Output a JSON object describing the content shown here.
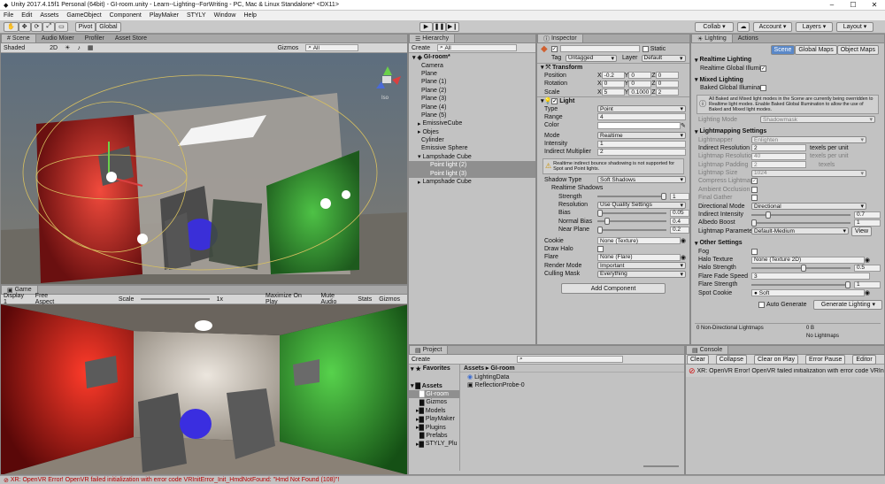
{
  "window": {
    "title": "Unity 2017.4.15f1 Personal (64bit) - GI-room.unity - Learn--Lighting--ForWriting - PC, Mac & Linux Standalone* <DX11>"
  },
  "menu": [
    "File",
    "Edit",
    "Assets",
    "GameObject",
    "Component",
    "PlayMaker",
    "STYLY",
    "Window",
    "Help"
  ],
  "toolbar": {
    "pivot": "Pivot",
    "global": "Global",
    "collab": "Collab",
    "account": "Account",
    "layers": "Layers",
    "layout": "Layout"
  },
  "scene": {
    "tabs": [
      "Scene",
      "Audio Mixer",
      "Profiler",
      "Asset Store"
    ],
    "shading": "Shaded",
    "mode2d": "2D",
    "gizmos": "Gizmos",
    "search": "All",
    "persp": "Iso"
  },
  "game": {
    "tab": "Game",
    "display": "Display 1",
    "aspect": "Free Aspect",
    "scale_label": "Scale",
    "scale_value": "1x",
    "opts": [
      "Maximize On Play",
      "Mute Audio",
      "Stats",
      "Gizmos"
    ]
  },
  "hierarchy": {
    "tab": "Hierarchy",
    "create": "Create",
    "search": "All",
    "scene": "GI-room*",
    "items": [
      "Camera",
      "Plane",
      "Plane (1)",
      "Plane (2)",
      "Plane (3)",
      "Plane (4)",
      "Plane (5)",
      "EmissiveCube",
      "Objes",
      "Cylinder",
      "Emissive Sphere",
      "Lampshade Cube",
      "Point light (2)",
      "Point light (3)",
      "Lampshade Cube"
    ]
  },
  "inspector": {
    "tab": "Inspector",
    "name": "",
    "static": "Static",
    "tag_label": "Tag",
    "tag": "Untagged",
    "layer_label": "Layer",
    "layer": "Default",
    "transform": {
      "title": "Transform",
      "position": [
        "Position",
        "-0.2",
        "0",
        "0"
      ],
      "rotation": [
        "Rotation",
        "0",
        "0",
        "0"
      ],
      "scale": [
        "Scale",
        "5",
        "0.1000",
        "2"
      ]
    },
    "light": {
      "title": "Light",
      "type": [
        "Type",
        "Point"
      ],
      "range": [
        "Range",
        "4"
      ],
      "color": "Color",
      "mode": [
        "Mode",
        "Realtime"
      ],
      "intensity": [
        "Intensity",
        "1"
      ],
      "indirect": [
        "Indirect Multiplier",
        "2"
      ],
      "warning": "Realtime indirect bounce shadowing is not supported for Spot and Point lights.",
      "shadow_type": [
        "Shadow Type",
        "Soft Shadows"
      ],
      "realtime_shadows": "Realtime Shadows",
      "strength": [
        "Strength",
        "1"
      ],
      "resolution": [
        "Resolution",
        "Use Quality Settings"
      ],
      "bias": [
        "Bias",
        "0.05"
      ],
      "normal_bias": [
        "Normal Bias",
        "0.4"
      ],
      "near_plane": [
        "Near Plane",
        "0.2"
      ],
      "cookie": [
        "Cookie",
        "None (Texture)"
      ],
      "draw_halo": "Draw Halo",
      "flare": [
        "Flare",
        "None (Flare)"
      ],
      "render_mode": [
        "Render Mode",
        "Important"
      ],
      "culling": [
        "Culling Mask",
        "Everything"
      ]
    },
    "add_component": "Add Component"
  },
  "lighting": {
    "tabs": [
      "Lighting",
      "Actions"
    ],
    "subtabs": [
      "Scene",
      "Global Maps",
      "Object Maps"
    ],
    "realtime": {
      "title": "Realtime Lighting",
      "gi": "Realtime Global Illumi"
    },
    "mixed": {
      "title": "Mixed Lighting",
      "baked": "Baked Global Illumina",
      "note": "All Baked and Mixed light modes in the Scene are currently being overridden to Realtime light modes. Enable Baked Global Illumination to allow the use of Baked and Mixed light modes.",
      "mode": [
        "Lighting Mode",
        "Shadowmask"
      ]
    },
    "settings": {
      "title": "Lightmapping Settings",
      "lightmapper": [
        "Lightmapper",
        "Enlighten"
      ],
      "indirect_res": [
        "Indirect Resolution",
        "2",
        "texels per unit"
      ],
      "lightmap_res": [
        "Lightmap Resolution",
        "40",
        "texels per unit"
      ],
      "padding": [
        "Lightmap Padding",
        "2",
        "texels"
      ],
      "size": [
        "Lightmap Size",
        "1024"
      ],
      "compress": "Compress Lightmaps",
      "ao": "Ambient Occlusion",
      "final_gather": "Final Gather",
      "directional": [
        "Directional Mode",
        "Directional"
      ],
      "indirect_int": [
        "Indirect Intensity",
        "0.7"
      ],
      "albedo": [
        "Albedo Boost",
        "1"
      ],
      "params": [
        "Lightmap Parameters",
        "Default-Medium",
        "View"
      ]
    },
    "other": {
      "title": "Other Settings",
      "fog": "Fog",
      "halo_tex": [
        "Halo Texture",
        "None (Texture 2D)"
      ],
      "halo_str": [
        "Halo Strength",
        "0.5"
      ],
      "flare_speed": [
        "Flare Fade Speed",
        "3"
      ],
      "flare_str": [
        "Flare Strength",
        "1"
      ],
      "spot": [
        "Spot Cookie",
        "Soft"
      ]
    },
    "auto": "Auto Generate",
    "generate": "Generate Lighting",
    "lightmaps": "0 Non-Directional Lightmaps",
    "size_val": "0 B",
    "no_lightmaps": "No Lightmaps"
  },
  "project": {
    "tab": "Project",
    "create": "Create",
    "favorites": "Favorites",
    "assets": "Assets",
    "breadcrumb": [
      "Assets",
      "GI-room"
    ],
    "folders": [
      "GI-room",
      "Gizmos",
      "Models",
      "PlayMaker",
      "Plugins",
      "Prefabs",
      "STYLY_Plu"
    ],
    "files": [
      "LightingData",
      "ReflectionProbe-0"
    ]
  },
  "console": {
    "tab": "Console",
    "buttons": [
      "Clear",
      "Collapse",
      "Clear on Play",
      "Error Pause",
      "Editor"
    ],
    "msg": "XR: OpenVR Error! OpenVR failed initialization with error code VRInitErr"
  },
  "status": "XR: OpenVR Error! OpenVR failed initialization with error code VRInitError_Init_HmdNotFound: \"Hmd Not Found (108)\"!"
}
